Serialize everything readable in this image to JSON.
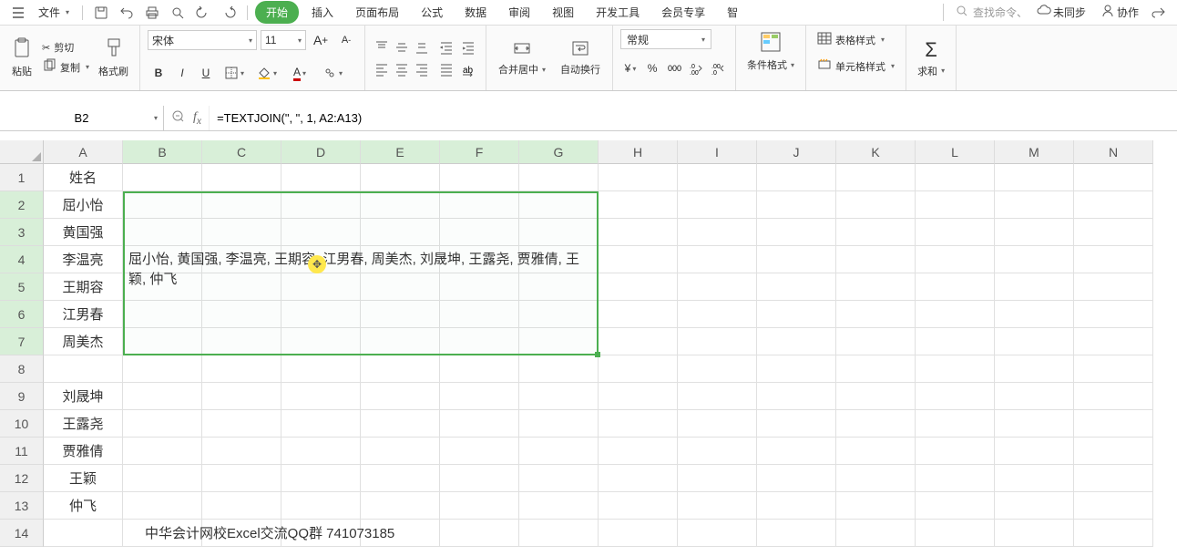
{
  "menu": {
    "file": "文件",
    "tabs": [
      "开始",
      "插入",
      "页面布局",
      "公式",
      "数据",
      "审阅",
      "视图",
      "开发工具",
      "会员专享",
      "智"
    ],
    "search_placeholder": "查找命令、",
    "unsync": "未同步",
    "collab": "协作"
  },
  "ribbon": {
    "paste": "粘贴",
    "cut": "剪切",
    "copy": "复制",
    "format_painter": "格式刷",
    "font_name": "宋体",
    "font_size": "11",
    "merge": "合并居中",
    "wrap": "自动换行",
    "number_format": "常规",
    "cond_format": "条件格式",
    "table_style": "表格样式",
    "cell_style": "单元格样式",
    "sum": "求和"
  },
  "formula_bar": {
    "name_box": "B2",
    "formula": "=TEXTJOIN(\", \", 1, A2:A13)"
  },
  "sheet": {
    "columns": [
      "A",
      "B",
      "C",
      "D",
      "E",
      "F",
      "G",
      "H",
      "I",
      "J",
      "K",
      "L",
      "M",
      "N"
    ],
    "rows": [
      1,
      2,
      3,
      4,
      5,
      6,
      7,
      8,
      9,
      10,
      11,
      12,
      13,
      14
    ],
    "a1": "姓名",
    "names": [
      "屈小怡",
      "黄国强",
      "李温亮",
      "王期容",
      "江男春",
      "周美杰",
      "",
      "刘晟坤",
      "王露尧",
      "贾雅倩",
      "王颖",
      "仲飞"
    ],
    "b2_result": "屈小怡, 黄国强, 李温亮, 王期容, 江男春, 周美杰, 刘晟坤, 王露尧, 贾雅倩, 王颖, 仲飞",
    "footer": "中华会计网校Excel交流QQ群  741073185"
  }
}
